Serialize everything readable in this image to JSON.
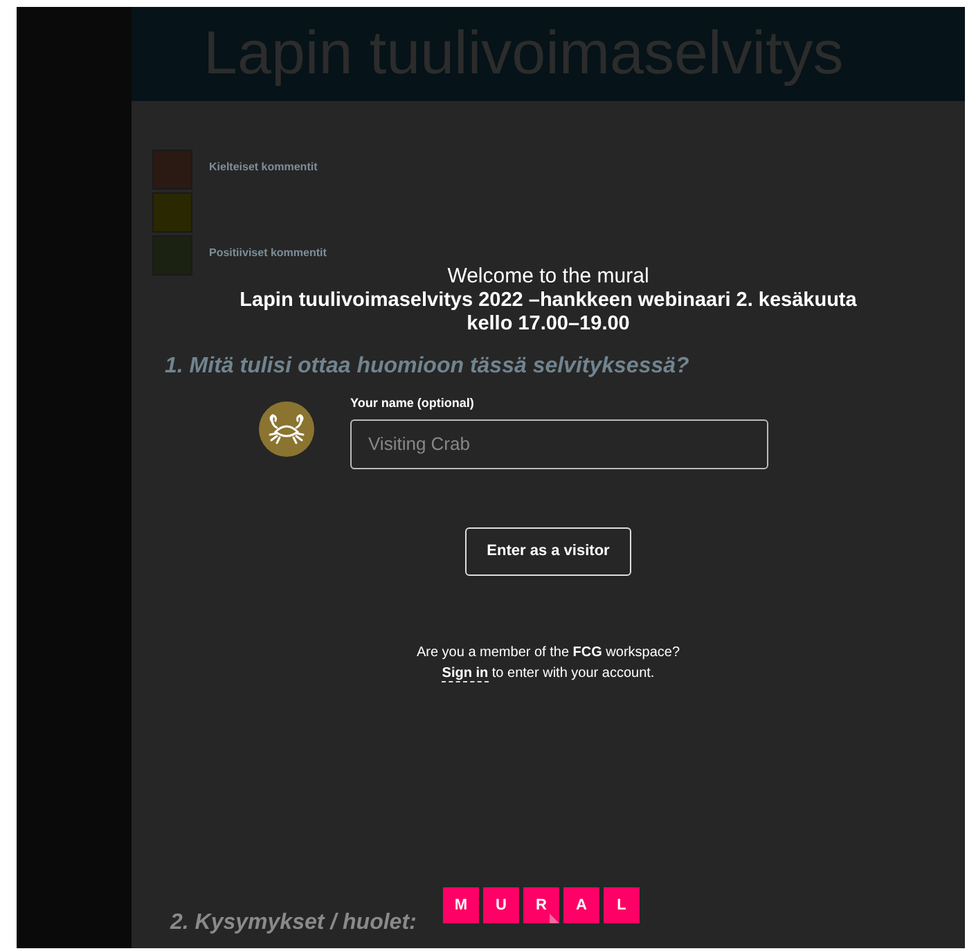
{
  "board": {
    "title": "Lapin tuulivoimaselvitys",
    "legend": [
      {
        "label": "Kielteiset kommentit",
        "color": "#2a1a13"
      },
      {
        "color": "#2a2800"
      },
      {
        "label": "Positiiviset kommentit",
        "color": "#1b2211"
      }
    ],
    "questions": [
      "1. Mitä tulisi ottaa huomioon tässä selvityksessä?",
      "2. Kysymykset / huolet:"
    ]
  },
  "dialog": {
    "greeting": "Welcome to the mural",
    "mural_title": "Lapin tuulivoimaselvitys 2022 –hankkeen webinaari 2. kesäkuuta kello 17.00–19.00",
    "name_label": "Your name (optional)",
    "name_field": {
      "placeholder": "Visiting Crab"
    },
    "enter_button": "Enter as a visitor",
    "member_text": "Are you a member of the **FCG** workspace?",
    "sign_in_link": "Sign in",
    "sign_in_text": "to enter with your account."
  },
  "logo": {
    "letters": [
      "M",
      "U",
      "R",
      "A",
      "L"
    ]
  }
}
